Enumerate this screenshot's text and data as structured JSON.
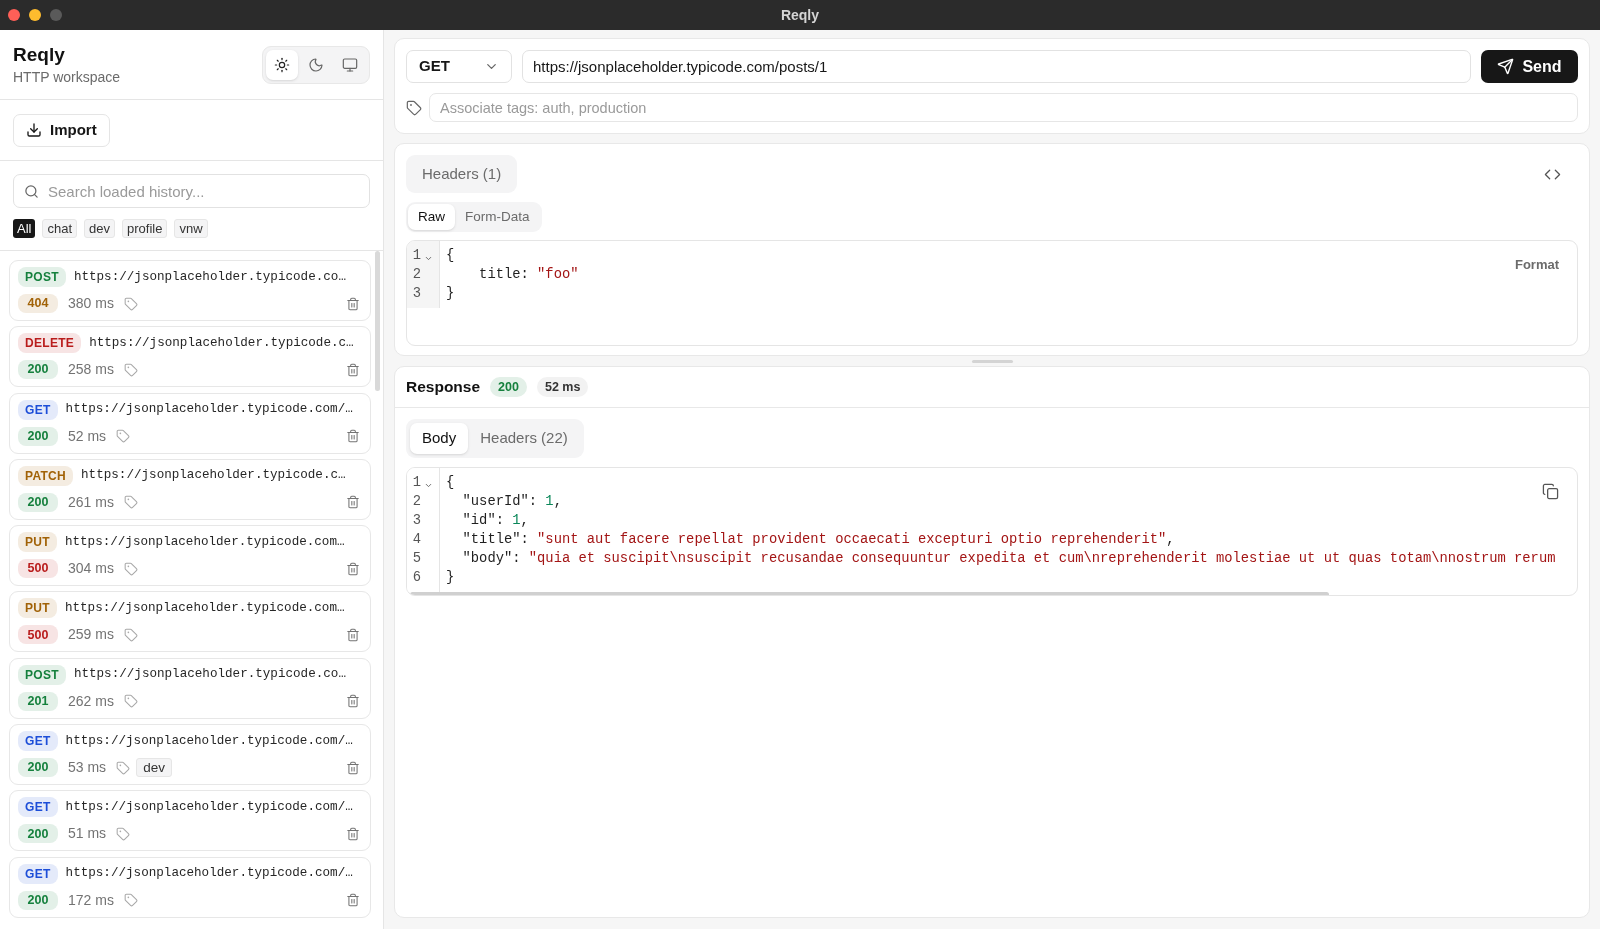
{
  "window": {
    "title": "Reqly"
  },
  "sidebar": {
    "app_title": "Reqly",
    "subtitle": "HTTP workspace",
    "theme_options": [
      {
        "kind": "light",
        "selected": true
      },
      {
        "kind": "dark",
        "selected": false
      },
      {
        "kind": "system",
        "selected": false
      }
    ],
    "import_button": "Import",
    "search": {
      "placeholder": "Search loaded history..."
    },
    "filters": [
      {
        "label": "All",
        "selected": true
      },
      {
        "label": "chat",
        "selected": false
      },
      {
        "label": "dev",
        "selected": false
      },
      {
        "label": "profile",
        "selected": false
      },
      {
        "label": "vnw",
        "selected": false
      }
    ],
    "history": [
      {
        "method": {
          "label": "POST",
          "color": "#15803d"
        },
        "url": "https://jsonplaceholder.typicode.co…",
        "status": {
          "label": "404",
          "color": "#a16207"
        },
        "duration": "380 ms"
      },
      {
        "method": {
          "label": "DELETE",
          "color": "#b91c1c"
        },
        "url": "https://jsonplaceholder.typicode.c…",
        "status": {
          "label": "200",
          "color": "#15803d"
        },
        "duration": "258 ms"
      },
      {
        "method": {
          "label": "GET",
          "color": "#1d4ed8"
        },
        "url": "https://jsonplaceholder.typicode.com/…",
        "status": {
          "label": "200",
          "color": "#15803d"
        },
        "duration": "52 ms"
      },
      {
        "method": {
          "label": "PATCH",
          "color": "#a16207"
        },
        "url": "https://jsonplaceholder.typicode.c…",
        "status": {
          "label": "200",
          "color": "#15803d"
        },
        "duration": "261 ms"
      },
      {
        "method": {
          "label": "PUT",
          "color": "#a16207"
        },
        "url": "https://jsonplaceholder.typicode.com…",
        "status": {
          "label": "500",
          "color": "#b91c1c"
        },
        "duration": "304 ms"
      },
      {
        "method": {
          "label": "PUT",
          "color": "#a16207"
        },
        "url": "https://jsonplaceholder.typicode.com…",
        "status": {
          "label": "500",
          "color": "#b91c1c"
        },
        "duration": "259 ms"
      },
      {
        "method": {
          "label": "POST",
          "color": "#15803d"
        },
        "url": "https://jsonplaceholder.typicode.co…",
        "status": {
          "label": "201",
          "color": "#15803d"
        },
        "duration": "262 ms"
      },
      {
        "method": {
          "label": "GET",
          "color": "#1d4ed8"
        },
        "url": "https://jsonplaceholder.typicode.com/…",
        "status": {
          "label": "200",
          "color": "#15803d"
        },
        "duration": "53 ms",
        "tags": [
          "dev"
        ]
      },
      {
        "method": {
          "label": "GET",
          "color": "#1d4ed8"
        },
        "url": "https://jsonplaceholder.typicode.com/…",
        "status": {
          "label": "200",
          "color": "#15803d"
        },
        "duration": "51 ms"
      },
      {
        "method": {
          "label": "GET",
          "color": "#1d4ed8"
        },
        "url": "https://jsonplaceholder.typicode.com/…",
        "status": {
          "label": "200",
          "color": "#15803d"
        },
        "duration": "172 ms"
      }
    ]
  },
  "request": {
    "method": "GET",
    "url": "https://jsonplaceholder.typicode.com/posts/1",
    "send_button": "Send",
    "tags_field": {
      "placeholder": "Associate tags: auth, production"
    },
    "tabs": [
      {
        "label": "Headers (1)",
        "selected": false
      }
    ],
    "body_modes": [
      {
        "label": "Raw",
        "selected": true
      },
      {
        "label": "Form-Data",
        "selected": false
      }
    ],
    "format_button": "Format",
    "body_lines": [
      {
        "number": "1",
        "foldable": true,
        "tokens": [
          {
            "kind": "plain",
            "text": "{"
          }
        ]
      },
      {
        "number": "2",
        "foldable": false,
        "tokens": [
          {
            "kind": "plain",
            "text": "    title: "
          },
          {
            "kind": "string",
            "text": "\"foo\""
          }
        ]
      },
      {
        "number": "3",
        "foldable": false,
        "tokens": [
          {
            "kind": "plain",
            "text": "}"
          }
        ]
      }
    ]
  },
  "response": {
    "title": "Response",
    "status": {
      "label": "200",
      "color": "#15803d"
    },
    "time": "52 ms",
    "tabs": [
      {
        "label": "Body",
        "selected": true
      },
      {
        "label": "Headers (22)",
        "selected": false
      }
    ],
    "body_lines": [
      {
        "number": "1",
        "foldable": true,
        "tokens": [
          {
            "kind": "plain",
            "text": "{"
          }
        ]
      },
      {
        "number": "2",
        "foldable": false,
        "tokens": [
          {
            "kind": "plain",
            "text": "  \"userId\": "
          },
          {
            "kind": "number",
            "text": "1"
          },
          {
            "kind": "plain",
            "text": ","
          }
        ]
      },
      {
        "number": "3",
        "foldable": false,
        "tokens": [
          {
            "kind": "plain",
            "text": "  \"id\": "
          },
          {
            "kind": "number",
            "text": "1"
          },
          {
            "kind": "plain",
            "text": ","
          }
        ]
      },
      {
        "number": "4",
        "foldable": false,
        "tokens": [
          {
            "kind": "plain",
            "text": "  \"title\": "
          },
          {
            "kind": "string",
            "text": "\"sunt aut facere repellat provident occaecati excepturi optio reprehenderit\""
          },
          {
            "kind": "plain",
            "text": ","
          }
        ]
      },
      {
        "number": "5",
        "foldable": false,
        "tokens": [
          {
            "kind": "plain",
            "text": "  \"body\": "
          },
          {
            "kind": "string",
            "text": "\"quia et suscipit\\nsuscipit recusandae consequuntur expedita et cum\\nreprehenderit molestiae ut ut quas totam\\nnostrum rerum"
          }
        ]
      },
      {
        "number": "6",
        "foldable": false,
        "tokens": [
          {
            "kind": "plain",
            "text": "}"
          }
        ]
      }
    ]
  }
}
